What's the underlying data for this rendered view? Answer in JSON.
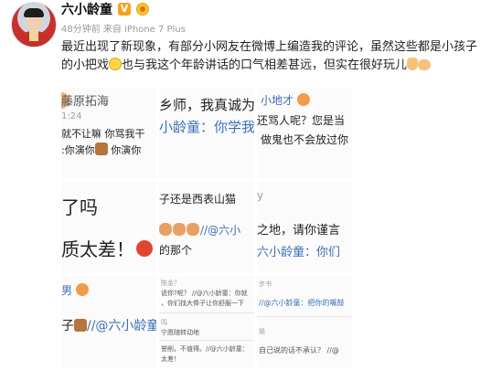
{
  "post": {
    "username": "六小龄童",
    "meta": "48分钟前 来自 iPhone 7 Plus",
    "text_part1": "最近出现了新现象，有部分小网友在微博上编造我的评论，虽然这些都是小孩子的小把戏",
    "text_part2": "也与我这个年龄讲话的口气相差甚远，但实在很好玩儿"
  },
  "grid": {
    "c1": {
      "name": "藤原拓海",
      "time": "1:24",
      "line1": "就不让嘛 你骂我干",
      "line2": ":你演你",
      "line2b": " 你演你"
    },
    "c2": {
      "line1": "乡师，我真诚为",
      "line2": "小龄童：你学我"
    },
    "c3": {
      "line1": "小地才",
      "line2": "还骂人呢？您是当",
      "line3": "做鬼也不会放过你"
    },
    "c4": {
      "line1": "了吗",
      "line2": "质太差！"
    },
    "c5": {
      "line1": "子还是西表山猫",
      "line2": "//@六小",
      "line3": "的那个"
    },
    "c6": {
      "line1": "y",
      "line2": "之地，请你谨言",
      "line3": "六小龄童：你们"
    },
    "c7": {
      "line1": "男",
      "line2": "子",
      "line3": "//@六小龄童"
    },
    "c8": {
      "r1": "陈金？",
      "r2": "说你?呢？ //@六小龄童：你就",
      "r3": "，你们找大俸子让你舒服一下",
      "r4": "鸣",
      "r5": "宁愿随转动地",
      "r6": "誉削，不值得。//@六小龄童：",
      "r7": "太差！"
    },
    "c9": {
      "r1": "步书",
      "r2": "//@六小龄童：把你的嘴鼓",
      "r3": "姐",
      "r4": "自己说的话不承认？ //@"
    }
  }
}
